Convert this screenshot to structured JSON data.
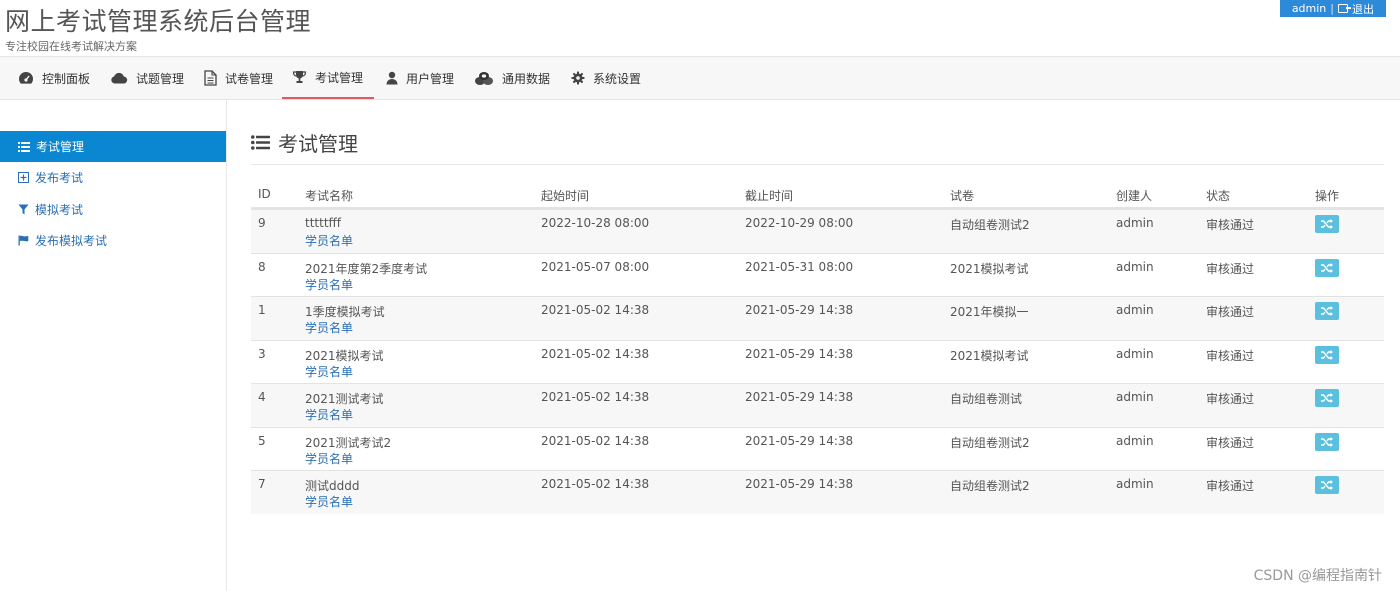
{
  "header": {
    "title": "网上考试管理系统后台管理",
    "subtitle": "专注校园在线考试解决方案",
    "user": "admin",
    "separator": "|",
    "logout_label": "退出"
  },
  "nav": [
    {
      "label": "控制面板",
      "icon": "dashboard-icon"
    },
    {
      "label": "试题管理",
      "icon": "cloud-icon"
    },
    {
      "label": "试卷管理",
      "icon": "document-icon"
    },
    {
      "label": "考试管理",
      "icon": "trophy-icon",
      "active": true
    },
    {
      "label": "用户管理",
      "icon": "user-icon"
    },
    {
      "label": "通用数据",
      "icon": "coins-icon"
    },
    {
      "label": "系统设置",
      "icon": "gear-icon"
    }
  ],
  "sidebar": [
    {
      "label": "考试管理",
      "icon": "list-icon",
      "active": true
    },
    {
      "label": "发布考试",
      "icon": "plus-square-icon"
    },
    {
      "label": "模拟考试",
      "icon": "filter-icon"
    },
    {
      "label": "发布模拟考试",
      "icon": "flag-icon"
    }
  ],
  "main": {
    "title": "考试管理"
  },
  "table": {
    "columns": [
      "ID",
      "考试名称",
      "起始时间",
      "截止时间",
      "试卷",
      "创建人",
      "状态",
      "操作"
    ],
    "link_label": "学员名单",
    "rows": [
      {
        "id": "9",
        "name": "tttttfff",
        "start": "2022-10-28 08:00",
        "end": "2022-10-29 08:00",
        "paper": "自动组卷测试2",
        "creator": "admin",
        "status": "审核通过"
      },
      {
        "id": "8",
        "name": "2021年度第2季度考试",
        "start": "2021-05-07 08:00",
        "end": "2021-05-31 08:00",
        "paper": "2021模拟考试",
        "creator": "admin",
        "status": "审核通过"
      },
      {
        "id": "1",
        "name": "1季度模拟考试",
        "start": "2021-05-02 14:38",
        "end": "2021-05-29 14:38",
        "paper": "2021年模拟一",
        "creator": "admin",
        "status": "审核通过"
      },
      {
        "id": "3",
        "name": "2021模拟考试",
        "start": "2021-05-02 14:38",
        "end": "2021-05-29 14:38",
        "paper": "2021模拟考试",
        "creator": "admin",
        "status": "审核通过"
      },
      {
        "id": "4",
        "name": "2021测试考试",
        "start": "2021-05-02 14:38",
        "end": "2021-05-29 14:38",
        "paper": "自动组卷测试",
        "creator": "admin",
        "status": "审核通过"
      },
      {
        "id": "5",
        "name": "2021测试考试2",
        "start": "2021-05-02 14:38",
        "end": "2021-05-29 14:38",
        "paper": "自动组卷测试2",
        "creator": "admin",
        "status": "审核通过"
      },
      {
        "id": "7",
        "name": "测试dddd",
        "start": "2021-05-02 14:38",
        "end": "2021-05-29 14:38",
        "paper": "自动组卷测试2",
        "creator": "admin",
        "status": "审核通过"
      }
    ]
  },
  "watermark": "CSDN @编程指南针",
  "colors": {
    "accent_blue": "#0a87d0",
    "link_blue": "#2a6fb5",
    "op_button": "#5bc0de",
    "active_underline": "#e05a5a"
  }
}
